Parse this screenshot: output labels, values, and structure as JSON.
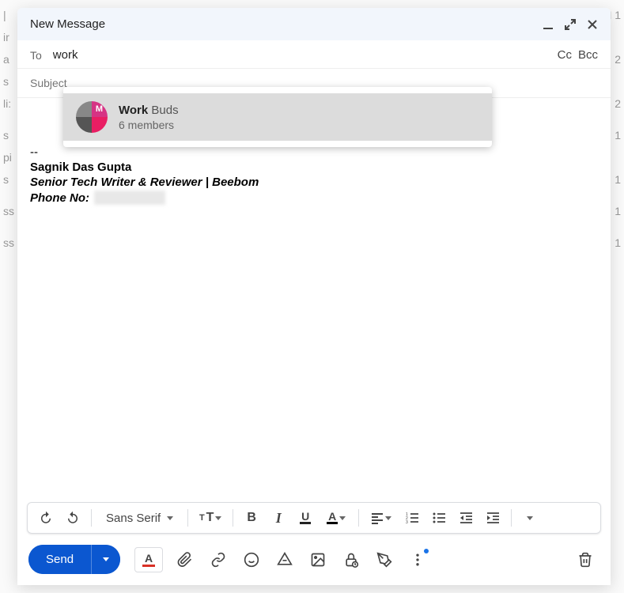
{
  "header": {
    "title": "New Message"
  },
  "recipients": {
    "to_label": "To",
    "to_value": "work",
    "cc_label": "Cc",
    "bcc_label": "Bcc"
  },
  "subject": {
    "placeholder": "Subject"
  },
  "suggestion": {
    "name_bold": "Work",
    "name_rest": " Buds",
    "subtitle": "6 members"
  },
  "signature": {
    "separator": "--",
    "name": "Sagnik Das Gupta",
    "title": "Senior Tech Writer & Reviewer | Beebom",
    "phone_label": "Phone No:"
  },
  "format_toolbar": {
    "font_name": "Sans Serif"
  },
  "bottom": {
    "send_label": "Send"
  }
}
